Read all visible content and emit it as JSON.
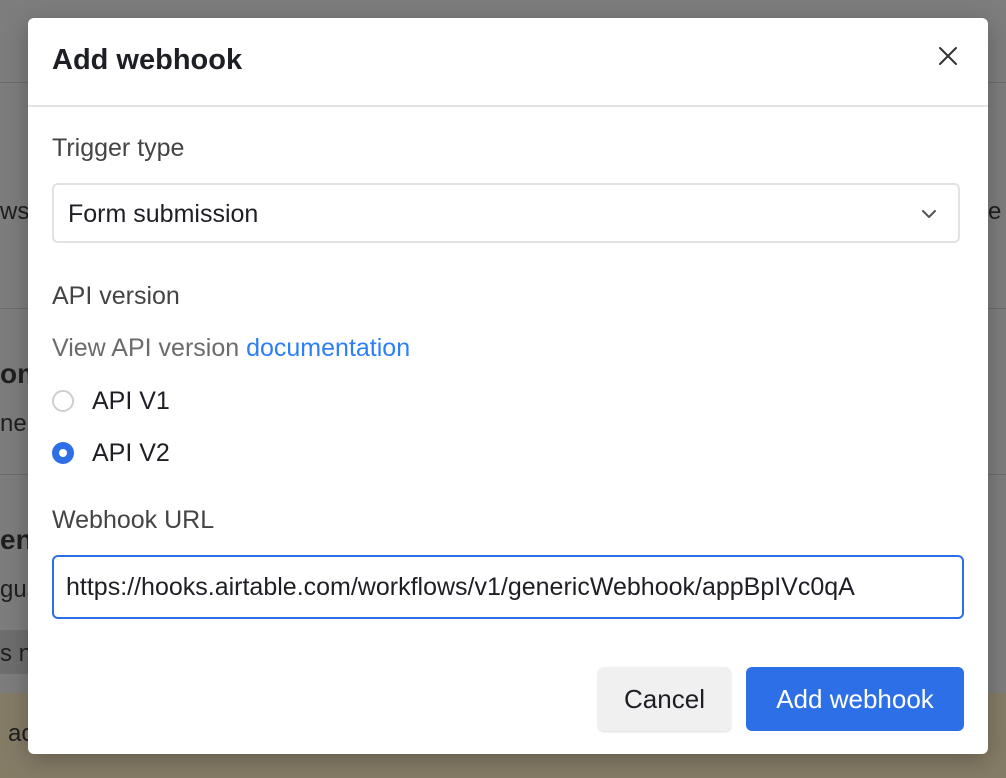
{
  "background": {
    "fragments": [
      "ws y",
      "e c",
      "om",
      "ne",
      "en",
      "gus",
      "s n",
      "ac"
    ]
  },
  "modal": {
    "title": "Add webhook",
    "close_icon": "close-icon",
    "trigger": {
      "label": "Trigger type",
      "value": "Form submission",
      "icon": "chevron-down-icon"
    },
    "api": {
      "label": "API version",
      "help_prefix": "View API version ",
      "help_link": "documentation",
      "options": [
        {
          "label": "API V1",
          "checked": false
        },
        {
          "label": "API V2",
          "checked": true
        }
      ]
    },
    "webhook_url": {
      "label": "Webhook URL",
      "value": "https://hooks.airtable.com/workflows/v1/genericWebhook/appBpIVc0qA"
    },
    "buttons": {
      "cancel": "Cancel",
      "submit": "Add webhook"
    }
  },
  "colors": {
    "accent": "#2d6fe6",
    "link": "#2d7ff9",
    "overlay": "#7d7d7d"
  }
}
